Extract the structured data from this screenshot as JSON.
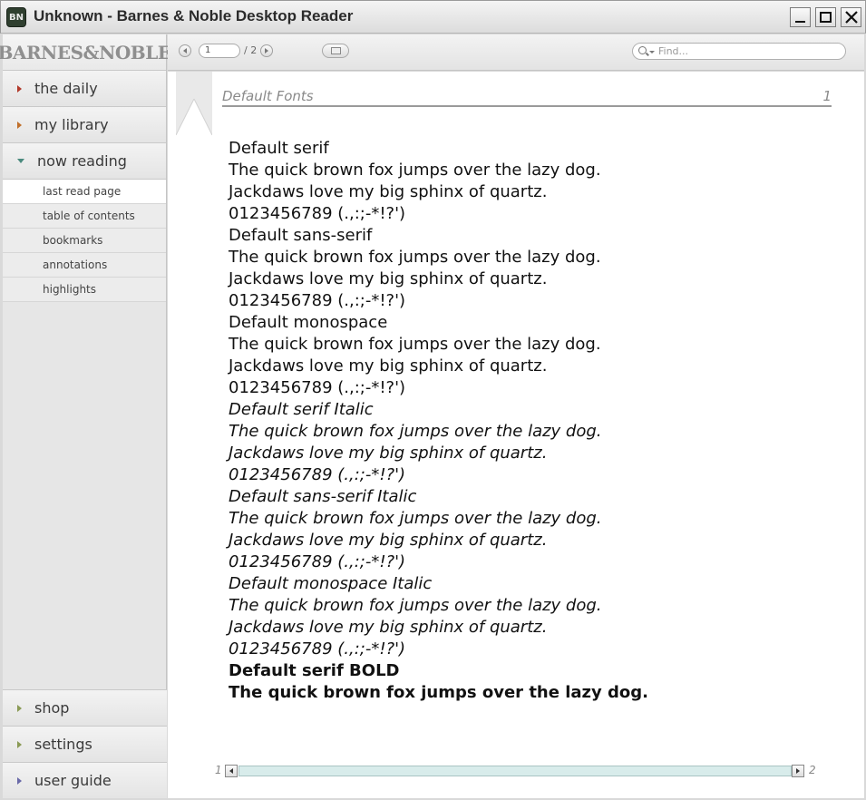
{
  "window": {
    "icon_text": "BN",
    "title": "Unknown - Barnes & Noble Desktop Reader"
  },
  "sidebar": {
    "brand": "BARNES&NOBLE",
    "top_items": [
      {
        "label": "the daily"
      },
      {
        "label": "my library"
      },
      {
        "label": "now reading"
      }
    ],
    "sub_items": [
      {
        "label": "last read page"
      },
      {
        "label": "table of contents"
      },
      {
        "label": "bookmarks"
      },
      {
        "label": "annotations"
      },
      {
        "label": "highlights"
      }
    ],
    "bottom_items": [
      {
        "label": "shop"
      },
      {
        "label": "settings"
      },
      {
        "label": "user guide"
      }
    ]
  },
  "toolbar": {
    "page_value": "1",
    "page_total": "/ 2",
    "search_placeholder": "Find..."
  },
  "page": {
    "header_title": "Default Fonts",
    "header_number": "1",
    "lines": [
      "Default serif",
      "The quick brown fox jumps over the lazy dog.",
      "Jackdaws love my big sphinx of quartz.",
      "0123456789 (.,:;-*!?')",
      "Default sans-serif",
      "The quick brown fox jumps over the lazy dog.",
      "Jackdaws love my big sphinx of quartz.",
      "0123456789 (.,:;-*!?')",
      "Default monospace",
      "The quick brown fox jumps over the lazy dog.",
      "Jackdaws love my big sphinx of quartz.",
      "0123456789 (.,:;-*!?')",
      "Default serif Italic",
      "The quick brown fox jumps over the lazy dog.",
      "Jackdaws love my big sphinx of quartz.",
      "0123456789 (.,:;-*!?')",
      "Default sans-serif Italic",
      "The quick brown fox jumps over the lazy dog.",
      "Jackdaws love my big sphinx of quartz.",
      "0123456789 (.,:;-*!?')",
      "Default monospace Italic",
      "The quick brown fox jumps over the lazy dog.",
      "Jackdaws love my big sphinx of quartz.",
      "0123456789 (.,:;-*!?')",
      "Default serif BOLD",
      "The quick brown fox jumps over the lazy dog."
    ],
    "scroll_start": "1",
    "scroll_end": "2"
  }
}
